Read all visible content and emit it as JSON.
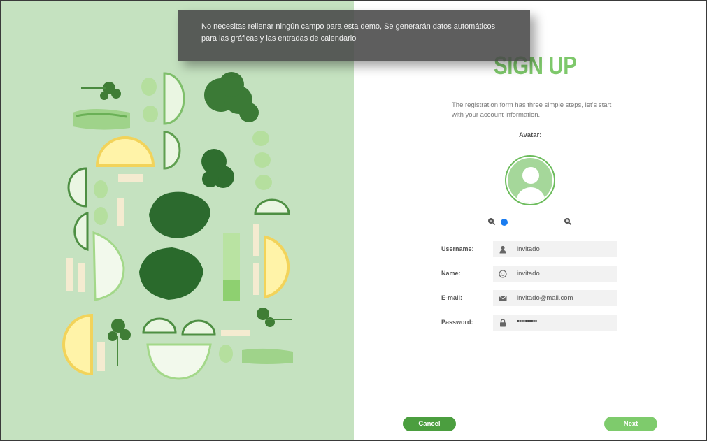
{
  "notice": {
    "text": "No necesitas rellenar ningún campo para esta demo, Se generarán datos automáticos para las gráficas y las entradas de calendario"
  },
  "form": {
    "title": "SIGN UP",
    "intro": "The registration form has three simple steps, let's start with your account information.",
    "avatar_label": "Avatar:",
    "zoom_level": 0.0,
    "fields": [
      {
        "label": "Username:",
        "value": "invitado",
        "icon": "user-icon"
      },
      {
        "label": "Name:",
        "value": "invitado",
        "icon": "smile-icon"
      },
      {
        "label": "E-mail:",
        "value": "invitado@mail.com",
        "icon": "envelope-icon"
      },
      {
        "label": "Password:",
        "value": "••••••••••",
        "icon": "lock-icon"
      }
    ],
    "cancel_label": "Cancel",
    "next_label": "Next"
  },
  "colors": {
    "accent_green": "#7ec86b",
    "cancel_green": "#4b9e3f",
    "slider_blue": "#1a7cf0",
    "photo_background": "#c7e3c2"
  }
}
